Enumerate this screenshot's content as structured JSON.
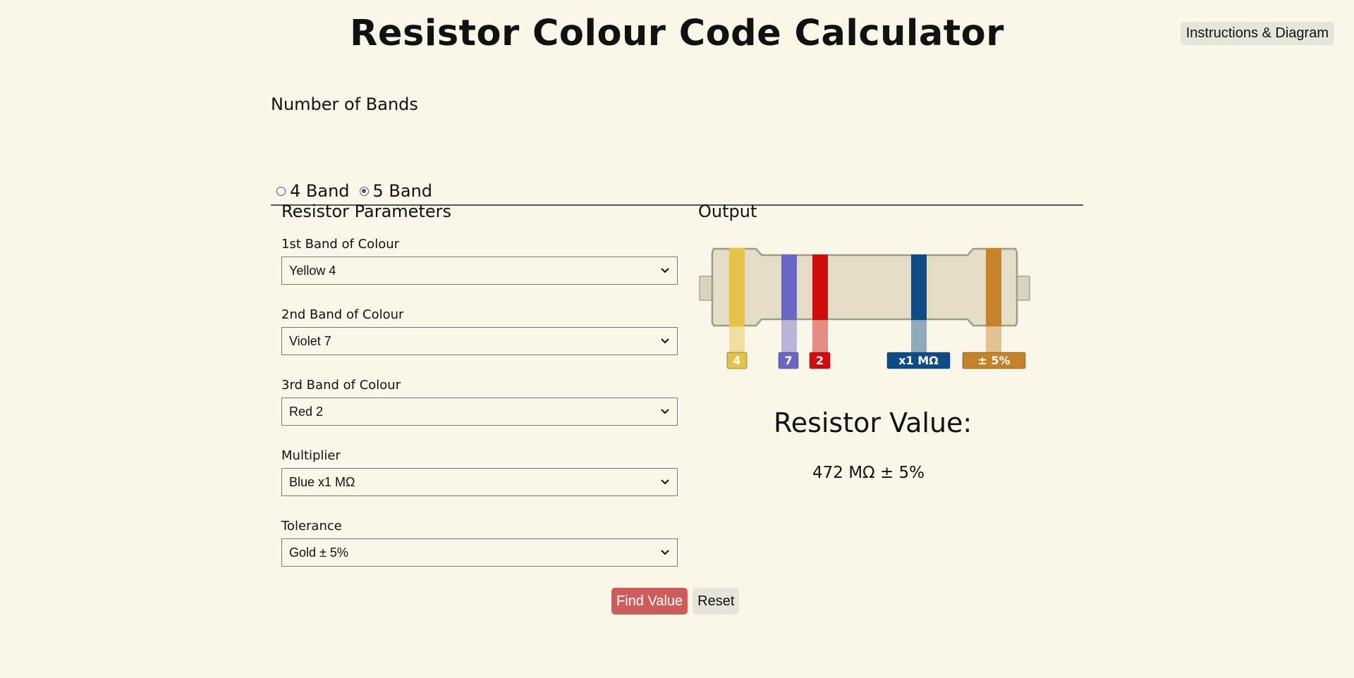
{
  "header": {
    "title": "Resistor Colour Code Calculator",
    "instructions_label": "Instructions & Diagram"
  },
  "bands": {
    "heading": "Number of Bands",
    "options": [
      {
        "label": "4 Band",
        "checked": false
      },
      {
        "label": "5 Band",
        "checked": true
      }
    ]
  },
  "params": {
    "heading": "Resistor Parameters",
    "fields": [
      {
        "label": "1st Band of Colour",
        "value": "Yellow 4"
      },
      {
        "label": "2nd Band of Colour",
        "value": "Violet 7"
      },
      {
        "label": "3rd Band of Colour",
        "value": "Red 2"
      },
      {
        "label": "Multiplier",
        "value": "Blue x1 MΩ"
      },
      {
        "label": "Tolerance",
        "value": "Gold ± 5%"
      }
    ]
  },
  "actions": {
    "find_label": "Find Value",
    "reset_label": "Reset"
  },
  "output": {
    "heading": "Output",
    "resistor_bands": [
      {
        "label": "4",
        "color": "#e5c24a"
      },
      {
        "label": "7",
        "color": "#6b66c6"
      },
      {
        "label": "2",
        "color": "#d10c0c"
      },
      {
        "label": "x1 MΩ",
        "color": "#0f4c86"
      },
      {
        "label": "± 5%",
        "color": "#c5822a"
      }
    ],
    "value_heading": "Resistor Value:",
    "value_text": "472 MΩ ± 5%"
  },
  "colors": {
    "background": "#faf6e8",
    "find_button": "#cd5c5c",
    "neutral_button": "#e7e4da",
    "resistor_body": "#e4ddc6"
  }
}
